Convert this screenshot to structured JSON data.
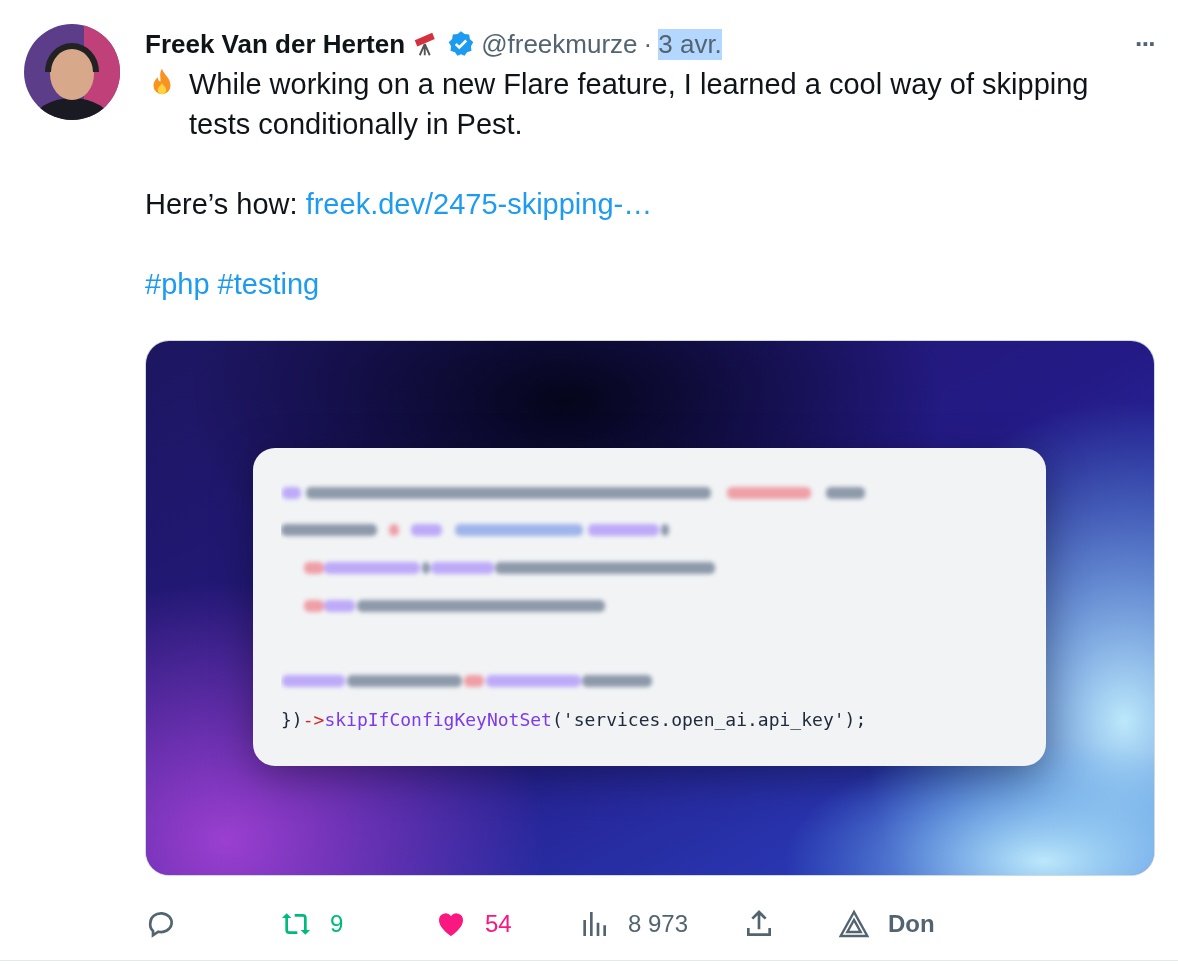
{
  "author": {
    "name": "Freek Van der Herten",
    "handle": "@freekmurze",
    "separator": "·",
    "date": {
      "text": "3 avr.",
      "highlighted": true
    },
    "verified": true
  },
  "more": "···",
  "body": [
    {
      "kind": "fire_text",
      "text": "While working on a new Flare feature, I learned a cool way of skipping tests conditionally in Pest."
    },
    {
      "kind": "link",
      "text": "Here’s how: ",
      "link": "freek.dev/2475-skipping-…"
    },
    {
      "kind": "tags",
      "tags": [
        "#php",
        "#testing"
      ]
    }
  ],
  "code_line": [
    {
      "text": "})",
      "color": "#1e293b"
    },
    {
      "text": "->",
      "color": "#dc2626"
    },
    {
      "text": "skipIfConfigKeyNotSet",
      "color": "#7c3aed"
    },
    {
      "text": "('services.open_ai.api_key');",
      "color": "#1e293b"
    }
  ],
  "actions": [
    {
      "kind": "reply",
      "color": "#536471"
    },
    {
      "kind": "retweet",
      "count": "9",
      "color": "#00ba7c"
    },
    {
      "kind": "like",
      "count": "54",
      "color": "#f91880"
    },
    {
      "kind": "views",
      "count": "8 973",
      "color": "#536471"
    },
    {
      "kind": "share",
      "color": "#536471"
    },
    {
      "kind": "grok",
      "count": "Don",
      "color": "#536471"
    }
  ]
}
